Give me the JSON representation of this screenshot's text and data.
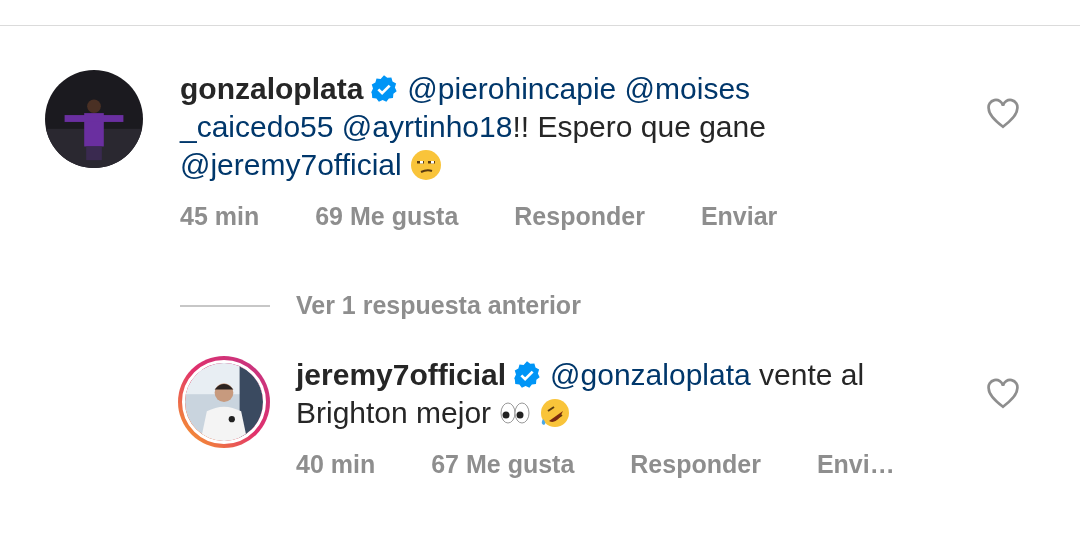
{
  "comments": [
    {
      "username": "gonzaloplata",
      "verified": true,
      "avatar_ring": false,
      "liked": false,
      "body": [
        {
          "kind": "mention",
          "text": "@pierohincapie"
        },
        {
          "kind": "mention",
          "text": "@moises"
        },
        {
          "kind": "break"
        },
        {
          "kind": "mention",
          "text": "_caicedo55"
        },
        {
          "kind": "mention",
          "text": "@ayrtinho18"
        },
        {
          "kind": "text",
          "text": "!! Espero que gane"
        },
        {
          "kind": "break"
        },
        {
          "kind": "mention",
          "text": "@jeremy7official"
        },
        {
          "kind": "unamused"
        }
      ],
      "time": "45 min",
      "likes": "69 Me gusta",
      "actions": [
        "Responder",
        "Enviar"
      ],
      "replies": {
        "link": "Ver 1 respuesta anterior",
        "items": [
          {
            "username": "jeremy7official",
            "verified": true,
            "avatar_ring": true,
            "liked": false,
            "body": [
              {
                "kind": "mention",
                "text": "@gonzaloplata"
              },
              {
                "kind": "text",
                "text": " vente al"
              },
              {
                "kind": "break"
              },
              {
                "kind": "text",
                "text": "Brighton mejor"
              },
              {
                "kind": "eyes"
              },
              {
                "kind": "laughing"
              }
            ],
            "time": "40 min",
            "likes": "67 Me gusta",
            "actions": [
              "Responder",
              "Envi…"
            ]
          }
        ]
      }
    }
  ]
}
